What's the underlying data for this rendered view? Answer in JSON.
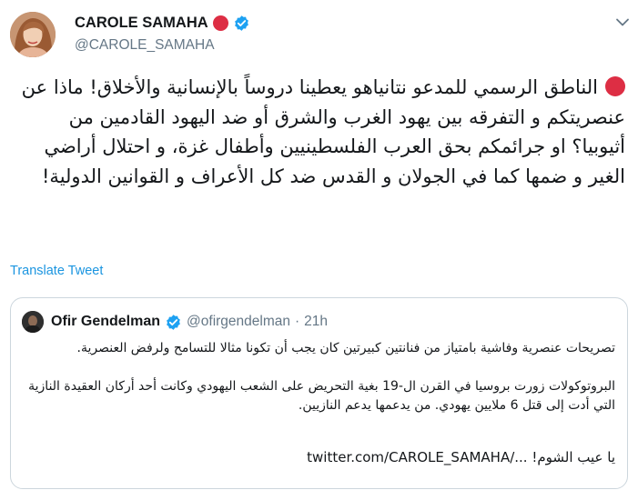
{
  "author": {
    "display_name": "CAROLE SAMAHA",
    "handle": "@CAROLE_SAMAHA"
  },
  "tweet": {
    "text": "الناطق الرسمي للمدعو نتانياهو يعطينا دروساً بالإنسانية والأخلاق! ماذا عن عنصريتكم و التفرقه بين يهود الغرب والشرق أو ضد اليهود القادمين من أثيوبيا؟ او جرائمكم بحق العرب الفلسطينيين وأطفال غزة، و احتلال أراضي الغير و ضمها كما في الجولان و القدس ضد كل الأعراف و القوانين الدولية!"
  },
  "translate_label": "Translate Tweet",
  "quoted_tweet": {
    "display_name": "Ofir Gendelman",
    "handle": "@ofirgendelman",
    "separator": "·",
    "time": "21h",
    "paragraph_1": "تصريحات عنصرية وفاشية بامتياز من فنانتين كبيرتين كان يجب أن تكونا مثالا للتسامح ولرفض العنصرية.",
    "paragraph_2": "البروتوكولات زورت بروسيا في القرن ال-19 بغية التحريض على الشعب اليهودي وكانت أحد أركان العقيدة النازية التي أدت إلى قتل 6 ملايين يهودي. من يدعمها يدعم النازيين.",
    "link_text": "twitter.com/CAROLE_SAMAHA/...",
    "trailing_text": "يا عيب الشوم!"
  },
  "colors": {
    "link": "#1b95e0",
    "verified": "#1da1f2",
    "red_circle": "#dd2e44",
    "secondary_text": "#657786",
    "border": "#ccd6dd"
  },
  "icons": {
    "author_badge": "verified-badge-icon",
    "name_emoji": "red-circle-icon",
    "menu": "chevron-down-icon",
    "quoted_badge": "verified-badge-icon"
  }
}
